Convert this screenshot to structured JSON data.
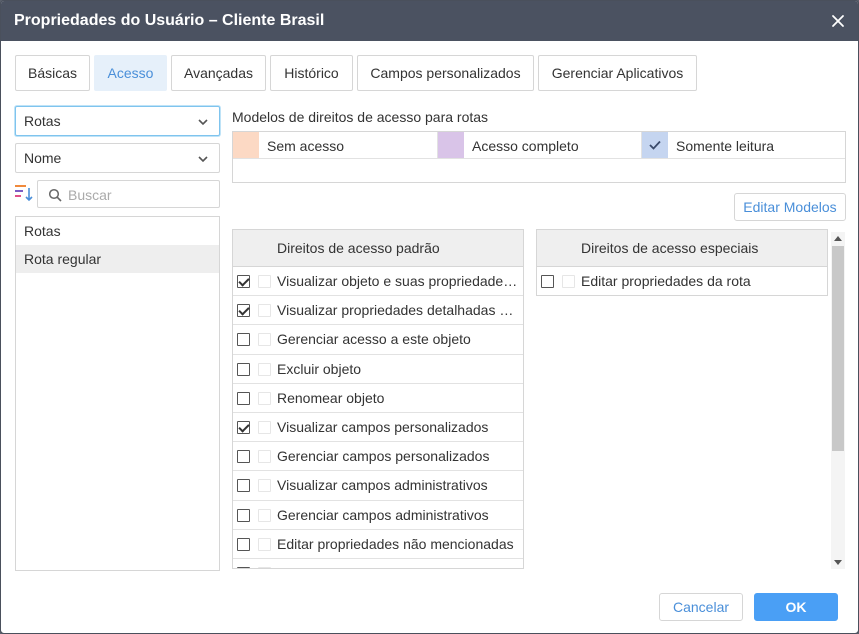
{
  "dialog": {
    "title": "Propriedades do Usuário – Cliente Brasil"
  },
  "tabs": [
    {
      "label": "Básicas",
      "active": false
    },
    {
      "label": "Acesso",
      "active": true
    },
    {
      "label": "Avançadas",
      "active": false
    },
    {
      "label": "Histórico",
      "active": false
    },
    {
      "label": "Campos personalizados",
      "active": false
    },
    {
      "label": "Gerenciar Aplicativos",
      "active": false
    }
  ],
  "left_panel": {
    "type_select": "Rotas",
    "sort_select": "Nome",
    "search_placeholder": "Buscar",
    "items": [
      {
        "label": "Rotas",
        "kind": "group"
      },
      {
        "label": "Rota regular",
        "kind": "item",
        "selected": true
      }
    ]
  },
  "models": {
    "label": "Modelos de direitos de acesso para rotas",
    "items": [
      {
        "label": "Sem acesso",
        "color": "#fcd9c4",
        "checked": false
      },
      {
        "label": "Acesso completo",
        "color": "#d9c4e8",
        "checked": false
      },
      {
        "label": "Somente leitura",
        "color": "#c5d5f0",
        "checked": true
      }
    ],
    "edit_button": "Editar Modelos"
  },
  "standard_rights": {
    "header": "Direitos de acesso padrão",
    "rows": [
      {
        "label": "Visualizar objeto e suas propriedades básicas",
        "checked": true
      },
      {
        "label": "Visualizar propriedades detalhadas do objeto",
        "checked": true
      },
      {
        "label": "Gerenciar acesso a este objeto",
        "checked": false
      },
      {
        "label": "Excluir objeto",
        "checked": false
      },
      {
        "label": "Renomear objeto",
        "checked": false
      },
      {
        "label": "Visualizar campos personalizados",
        "checked": true
      },
      {
        "label": "Gerenciar campos personalizados",
        "checked": false
      },
      {
        "label": "Visualizar campos administrativos",
        "checked": false
      },
      {
        "label": "Gerenciar campos administrativos",
        "checked": false
      },
      {
        "label": "Editar propriedades não mencionadas",
        "checked": false
      },
      {
        "label": "Alterar ícone",
        "checked": false
      }
    ]
  },
  "special_rights": {
    "header": "Direitos de acesso especiais",
    "rows": [
      {
        "label": "Editar propriedades da rota",
        "checked": false
      }
    ]
  },
  "footer": {
    "cancel": "Cancelar",
    "ok": "OK"
  },
  "colors": {
    "titlebar": "#4b5261",
    "accent": "#4a8fd9",
    "primary_button": "#4a9ff5"
  }
}
